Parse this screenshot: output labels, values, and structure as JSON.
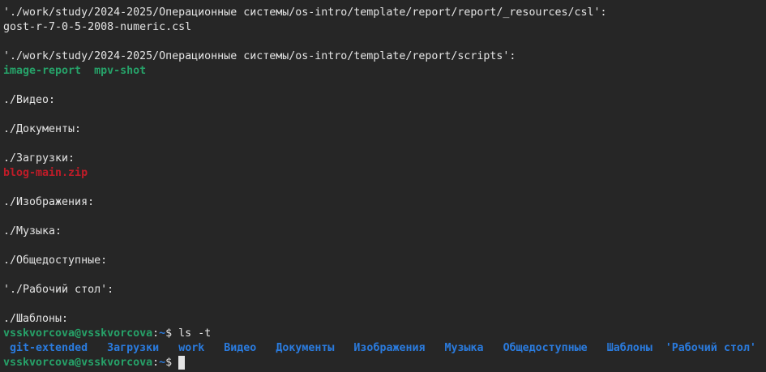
{
  "terminal": {
    "lines": [
      "'./work/study/2024-2025/Операционные системы/os-intro/template/report/report/_resources/csl':",
      "gost-r-7-0-5-2008-numeric.csl",
      "",
      "'./work/study/2024-2025/Операционные системы/os-intro/template/report/scripts':",
      "",
      "",
      "./Видео:",
      "",
      "./Документы:",
      "",
      "./Загрузки:",
      "",
      "",
      "./Изображения:",
      "",
      "./Музыка:",
      "",
      "./Общедоступные:",
      "",
      "'./Рабочий стол':",
      "",
      "./Шаблоны:"
    ],
    "scripts_files": [
      "image-report",
      "mpv-shot"
    ],
    "downloads_files": [
      "blog-main.zip"
    ],
    "prompt1": {
      "user_host": "vsskvorcova@vsskvorcova",
      "path_sep": ":~$ ",
      "command": "ls -t"
    },
    "ls_output": [
      "git-extended",
      "Загрузки",
      "work",
      "Видео",
      "Документы",
      "Изображения",
      "Музыка",
      "Общедоступные",
      "Шаблоны",
      "'Рабочий стол'"
    ],
    "prompt2": {
      "user_host": "vsskvorcova@vsskvorcova",
      "path_sep": ":~$ ",
      "command": ""
    }
  },
  "colors": {
    "background": "#262626",
    "text": "#e4e4e4",
    "executable": "#26a269",
    "archive": "#c01c28",
    "directory": "#2a7bde"
  }
}
